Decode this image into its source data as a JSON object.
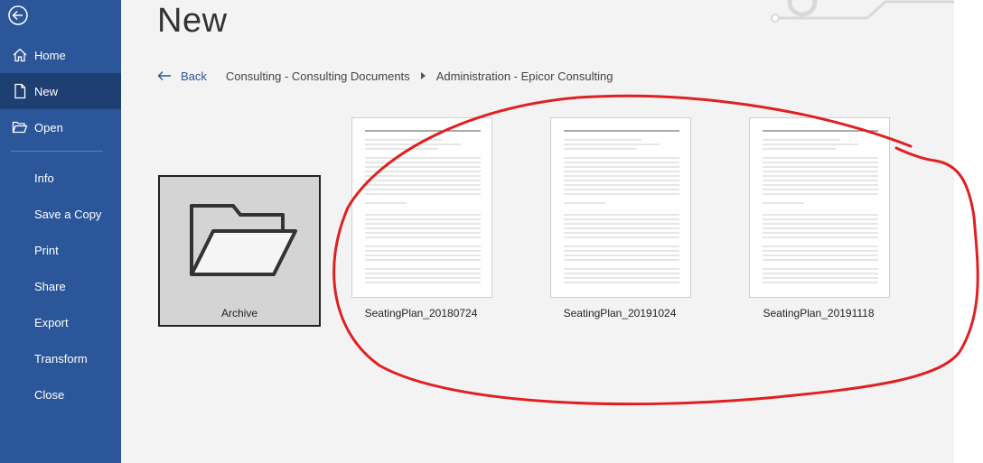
{
  "sidebar": {
    "items": [
      {
        "label": "Home"
      },
      {
        "label": "New"
      },
      {
        "label": "Open"
      },
      {
        "label": "Info"
      },
      {
        "label": "Save a Copy"
      },
      {
        "label": "Print"
      },
      {
        "label": "Share"
      },
      {
        "label": "Export"
      },
      {
        "label": "Transform"
      },
      {
        "label": "Close"
      }
    ],
    "active": "New",
    "color": "#2b579a",
    "active_color": "#1e3f72"
  },
  "page": {
    "title": "New"
  },
  "breadcrumb": {
    "back_label": "Back",
    "items": [
      "Consulting - Consulting Documents",
      "Administration - Epicor Consulting"
    ]
  },
  "tiles": [
    {
      "type": "folder",
      "label": "Archive",
      "icon": "folder-open-icon"
    },
    {
      "type": "document",
      "label": "SeatingPlan_20180724"
    },
    {
      "type": "document",
      "label": "SeatingPlan_20191024"
    },
    {
      "type": "document",
      "label": "SeatingPlan_20191118"
    }
  ],
  "annotation": {
    "color": "#e02020"
  }
}
